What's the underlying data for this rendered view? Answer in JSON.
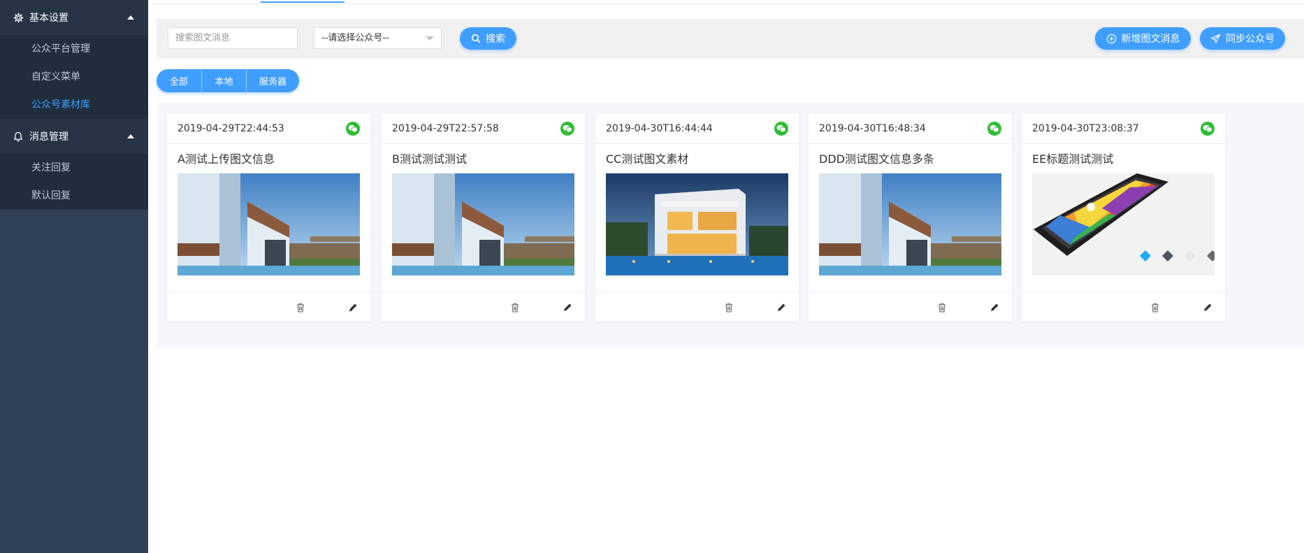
{
  "sidebar": {
    "groups": [
      {
        "label": "基本设置",
        "icon": "gear-icon",
        "items": [
          {
            "label": "公众平台管理"
          },
          {
            "label": "自定义菜单"
          },
          {
            "label": "公众号素材库",
            "active": true
          }
        ]
      },
      {
        "label": "消息管理",
        "icon": "bell-icon",
        "items": [
          {
            "label": "关注回复"
          },
          {
            "label": "默认回复"
          }
        ]
      }
    ]
  },
  "toolbar": {
    "search_placeholder": "搜索图文消息",
    "select_value": "--请选择公众号--",
    "search_label": "搜索",
    "add_label": "新增图文消息",
    "sync_label": "同步公众号"
  },
  "filter": {
    "tabs": [
      "全部",
      "本地",
      "服务器"
    ]
  },
  "cards": [
    {
      "time": "2019-04-29T22:44:53",
      "title": "A测试上传图文信息",
      "image": "modern-house-photo"
    },
    {
      "time": "2019-04-29T22:57:58",
      "title": "B测试测试测试",
      "image": "modern-house-photo"
    },
    {
      "time": "2019-04-30T16:44:44",
      "title": "CC测试图文素材",
      "image": "night-villa-photo"
    },
    {
      "time": "2019-04-30T16:48:34",
      "title": "DDD测试图文信息多条",
      "image": "modern-house-photo"
    },
    {
      "time": "2019-04-30T23:08:37",
      "title": "EE标题测试测试",
      "image": "phone-product-photo"
    }
  ],
  "colors": {
    "sidebar": "#304156",
    "accent": "#409eff",
    "wechat": "#2fbd36"
  }
}
